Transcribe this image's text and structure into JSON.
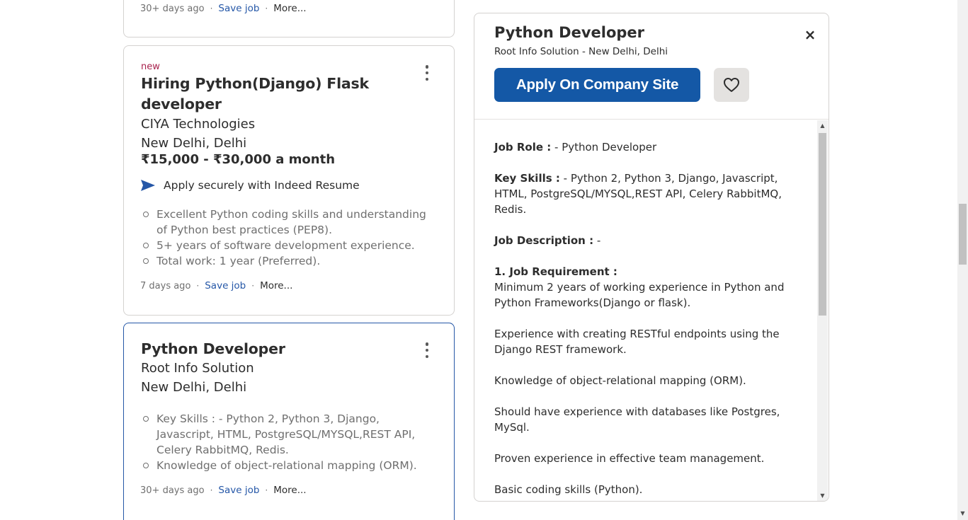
{
  "top_card": {
    "posted": "30+ days ago",
    "save_label": "Save job",
    "more_label": "More..."
  },
  "card_django": {
    "badge": "new",
    "title_line1": "Hiring Python(Django) Flask",
    "title_line2": "developer",
    "company": "CIYA Technologies",
    "location": "New Delhi, Delhi",
    "salary": "₹15,000 - ₹30,000 a month",
    "apply_secure": "Apply securely with Indeed Resume",
    "snippet": [
      "Excellent Python coding skills and understanding of Python best practices (PEP8).",
      "5+ years of software development experience.",
      "Total work: 1 year (Preferred)."
    ],
    "posted": "7 days ago",
    "save_label": "Save job",
    "more_label": "More..."
  },
  "card_python": {
    "title": "Python Developer",
    "company": "Root Info Solution",
    "location": "New Delhi, Delhi",
    "snippet": [
      "Key Skills : - Python 2, Python 3, Django, Javascript, HTML, PostgreSQL/MYSQL,REST API, Celery RabbitMQ, Redis.",
      "Knowledge of object-relational mapping (ORM)."
    ],
    "posted": "30+ days ago",
    "save_label": "Save job",
    "more_label": "More..."
  },
  "detail": {
    "title": "Python Developer",
    "subtitle": "Root Info Solution - New Delhi, Delhi",
    "apply_label": "Apply On Company Site",
    "close_glyph": "×",
    "job_role_label": "Job Role :",
    "job_role_value": " - Python Developer",
    "key_skills_label": "Key Skills :",
    "key_skills_value": " - Python 2, Python 3, Django, Javascript, HTML, PostgreSQL/MYSQL,REST API, Celery RabbitMQ, Redis.",
    "job_desc_label": "Job Description :",
    "job_desc_value": " -",
    "req_label": "1. Job Requirement :",
    "req_value": "Minimum 2 years of working experience in Python and Python Frameworks(Django or flask).",
    "para1": "Experience with creating RESTful endpoints using the Django REST framework.",
    "para2": "Knowledge of object-relational mapping (ORM).",
    "para3": "Should have experience with databases like Postgres, MySql.",
    "para4": "Proven experience in effective team management.",
    "para5": "Basic coding skills (Python)."
  },
  "colors": {
    "accent": "#2557a7",
    "apply_button": "#1458a6",
    "new_badge": "#a9234e",
    "text": "#2d2d2d",
    "muted": "#6f6f6f",
    "border": "#d4d2d0"
  },
  "icons": {
    "kebab": "kebab-menu-icon",
    "send": "send-arrow-icon",
    "heart": "heart-outline-icon",
    "close": "close-icon"
  }
}
